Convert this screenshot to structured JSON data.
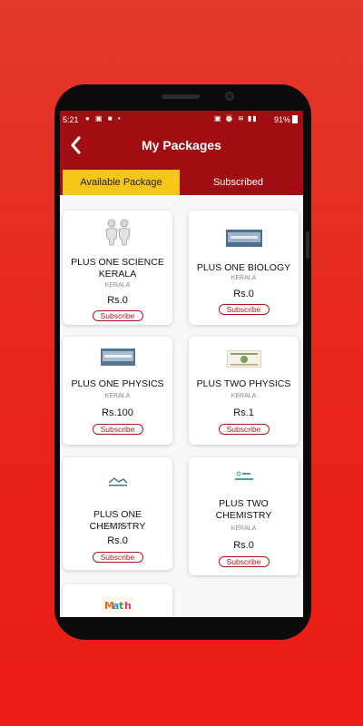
{
  "status_bar": {
    "time": "5:21",
    "notif_icons": "● ▣ ■ •",
    "sys_icons": "▣ ⏰ ≋ ▮▮",
    "battery": "91%"
  },
  "header": {
    "title": "My Packages",
    "back_icon": "chevron-left-icon"
  },
  "tabs": [
    {
      "label": "Available Package",
      "active": true
    },
    {
      "label": "Subscribed",
      "active": false
    }
  ],
  "packages": [
    {
      "name": "PLUS ONE SCIENCE KERALA",
      "region": "KERALA",
      "price": "Rs.0",
      "action": "Subscribe"
    },
    {
      "name": "PLUS ONE BIOLOGY",
      "region": "KERALA",
      "price": "Rs.0",
      "action": "Subscribe"
    },
    {
      "name": "PLUS ONE PHYSICS",
      "region": "KERALA",
      "price": "Rs.100",
      "action": "Subscribe"
    },
    {
      "name": "PLUS TWO PHYSICS",
      "region": "KERALA",
      "price": "Rs.1",
      "action": "Subscribe"
    },
    {
      "name": "PLUS ONE CHEMISTRY",
      "region": "KERALA",
      "price": "Rs.0",
      "action": "Subscribe"
    },
    {
      "name": "PLUS TWO CHEMISTRY",
      "region": "KERALA",
      "price": "Rs.0",
      "action": "Subscribe"
    }
  ],
  "colors": {
    "header_bg": "#a10e12",
    "active_tab": "#f5c518",
    "subscribe_accent": "#b0161a",
    "page_bg": "#e8261c"
  }
}
